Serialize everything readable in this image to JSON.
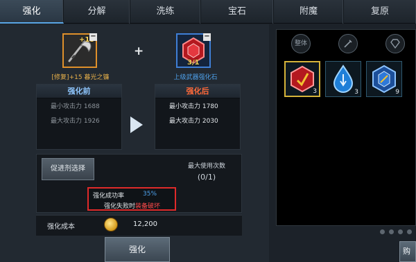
{
  "tabs": [
    {
      "label": "强化",
      "active": true
    },
    {
      "label": "分解",
      "active": false
    },
    {
      "label": "洗练",
      "active": false
    },
    {
      "label": "宝石",
      "active": false
    },
    {
      "label": "附魔",
      "active": false
    },
    {
      "label": "复原",
      "active": false
    }
  ],
  "item_slot": {
    "enhance_level": "+15",
    "name": "[修复]+15 暮光之镰",
    "icon": "scythe-icon"
  },
  "gem_slot": {
    "count": "3/1",
    "name": "上级武器强化石",
    "icon": "red-hex-gem-icon"
  },
  "plus_symbol": "+",
  "before": {
    "title": "强化前",
    "min_attack": "最小攻击力 1688",
    "max_attack": "最大攻击力 1926"
  },
  "after": {
    "title": "强化后",
    "min_attack": "最小攻击力 1780",
    "max_attack": "最大攻击力 2030"
  },
  "promoter_button": "促进剂选择",
  "max_uses": {
    "label": "最大使用次数",
    "value": "(0/1)"
  },
  "success": {
    "label": "强化成功率",
    "rate": "35%"
  },
  "failure": {
    "prefix": "强化失败时",
    "warning": "装备破坏"
  },
  "cost": {
    "label": "强化成本",
    "value": "12,200",
    "icon": "gold-coin-icon"
  },
  "enhance_button": "强化",
  "inventory": {
    "filters": [
      {
        "label": "整体",
        "icon": "all-filter-icon"
      },
      {
        "label": "",
        "icon": "weapon-filter-icon"
      },
      {
        "label": "",
        "icon": "diamond-filter-icon"
      }
    ],
    "items": [
      {
        "icon": "red-gem-icon",
        "qty": "3",
        "selected": true
      },
      {
        "icon": "blue-drop-gem-icon",
        "qty": "3",
        "selected": false
      },
      {
        "icon": "blue-hex-gem-icon",
        "qty": "9",
        "selected": false
      }
    ],
    "page_dots": 4
  },
  "partial_button": "购"
}
